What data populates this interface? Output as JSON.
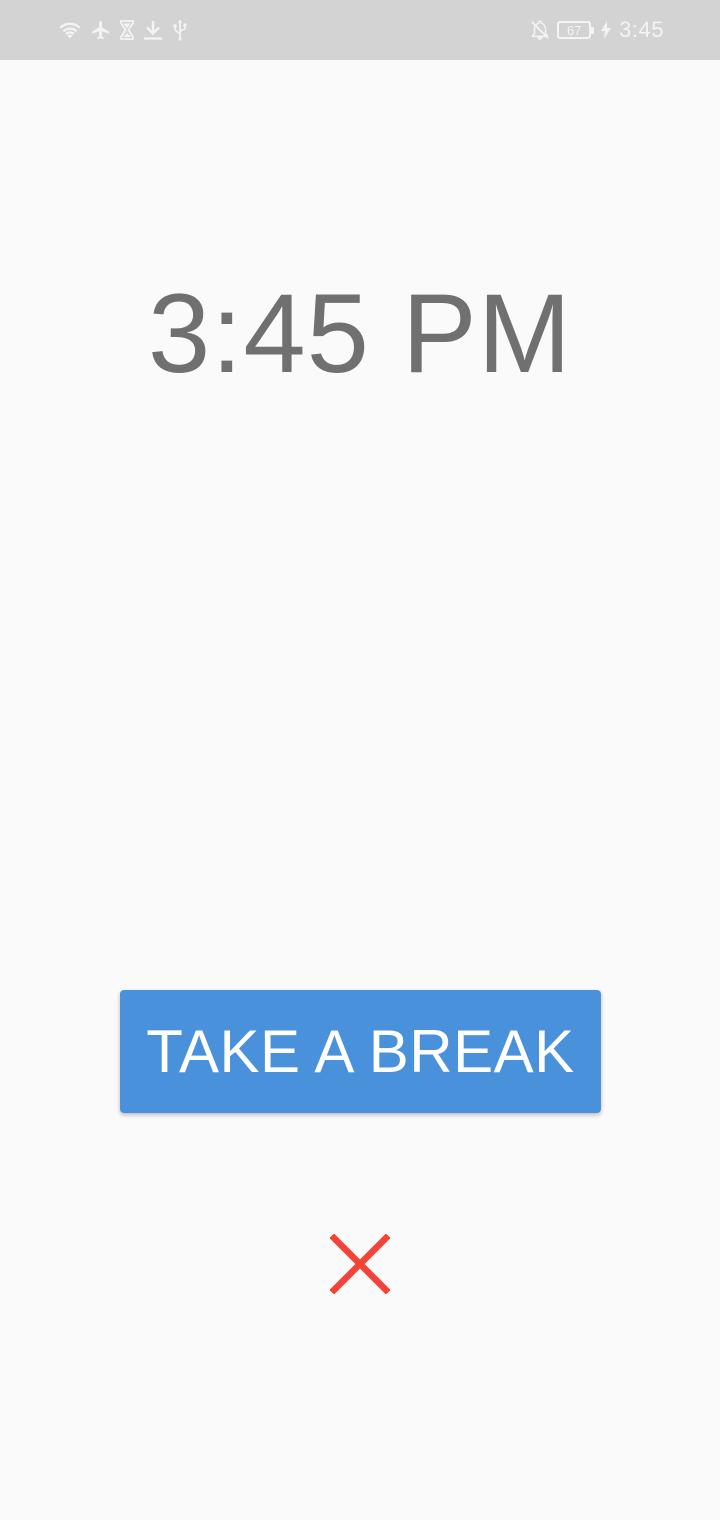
{
  "status_bar": {
    "left_icons": [
      "wifi-icon",
      "airplane-icon",
      "hourglass-icon",
      "download-icon",
      "usb-icon"
    ],
    "right_icons": [
      "notifications-off-icon",
      "battery-icon",
      "charging-icon"
    ],
    "battery_level": "67",
    "time": "3:45"
  },
  "main": {
    "clock_text": "3:45 PM",
    "break_button_label": "TAKE A BREAK",
    "close_icon": "close-icon"
  },
  "colors": {
    "status_bar_bg": "#d3d3d3",
    "background": "#fafafa",
    "clock_text": "#707070",
    "button_bg": "#4a91dc",
    "close_icon": "#f44336"
  }
}
